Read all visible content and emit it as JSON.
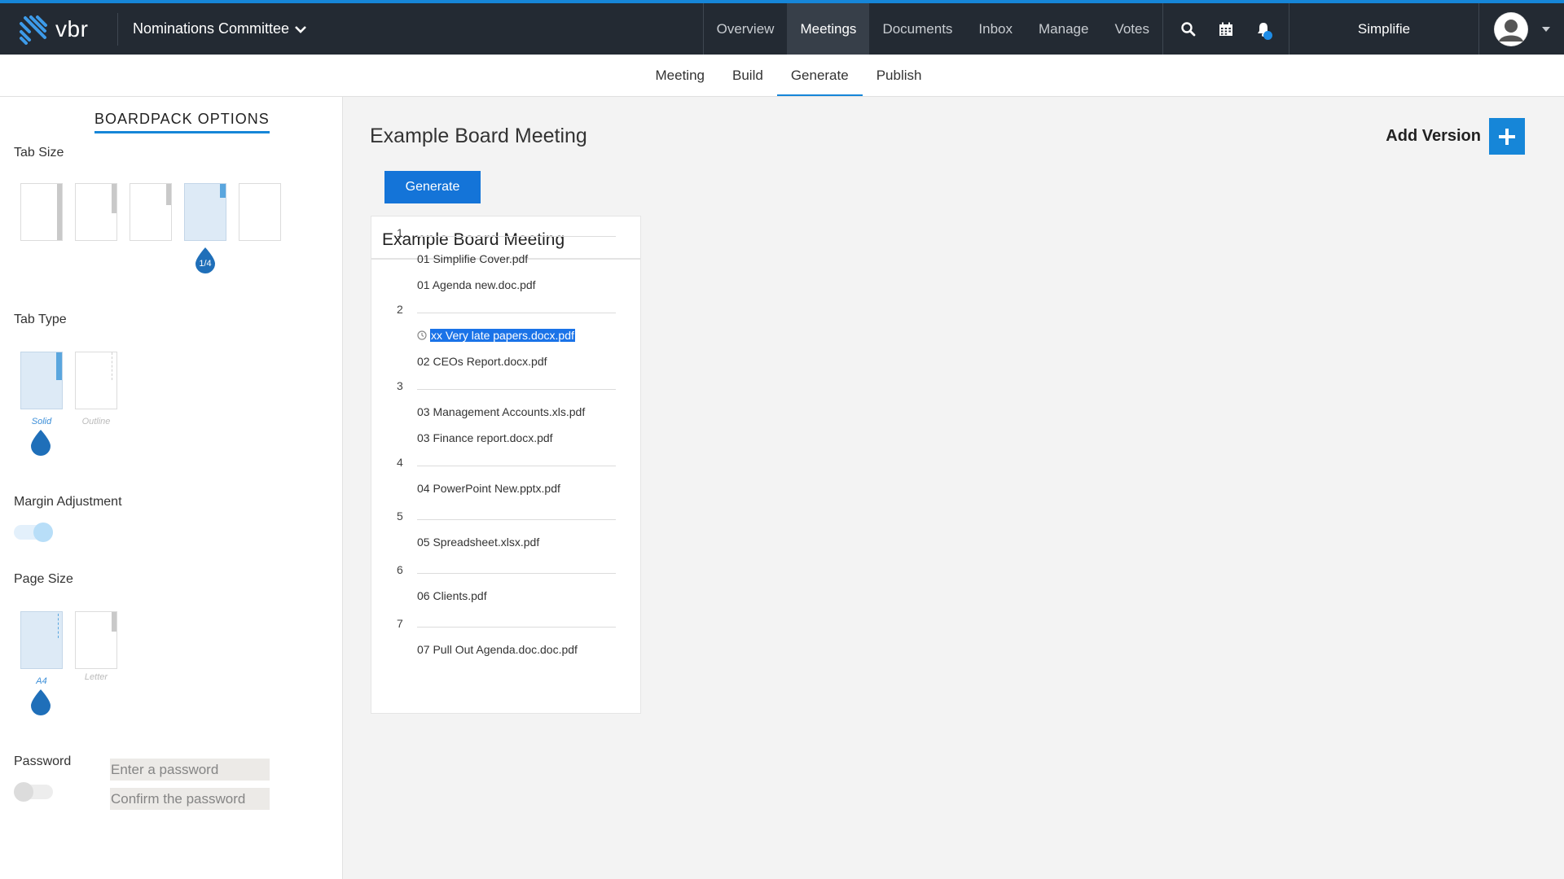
{
  "brand": {
    "name": "vbr",
    "accent": "#1686d8",
    "nav_bg": "#232a33"
  },
  "header": {
    "committee": "Nominations Committee",
    "nav": [
      "Overview",
      "Meetings",
      "Documents",
      "Inbox",
      "Manage",
      "Votes"
    ],
    "active_nav": "Meetings",
    "icons": [
      "search-icon",
      "calendar-icon",
      "bell-icon"
    ],
    "org": "Simplifie"
  },
  "subnav": {
    "items": [
      "Meeting",
      "Build",
      "Generate",
      "Publish"
    ],
    "active": "Generate"
  },
  "sidebar": {
    "title": "BOARDPACK OPTIONS",
    "tab_size": {
      "label": "Tab Size",
      "selected_badge": "1/4",
      "selected_index": 3
    },
    "tab_type": {
      "label": "Tab Type",
      "options": [
        "Solid",
        "Outline"
      ],
      "selected": "Solid"
    },
    "margin": {
      "label": "Margin Adjustment",
      "enabled": true
    },
    "page_size": {
      "label": "Page Size",
      "options": [
        "A4",
        "Letter"
      ],
      "selected": "A4"
    },
    "password": {
      "label": "Password",
      "enabled": false,
      "placeholder": "Enter a password",
      "confirm_placeholder": "Confirm the password"
    }
  },
  "main": {
    "title": "Example Board Meeting",
    "add_version_label": "Add Version",
    "generate_label": "Generate",
    "pack": {
      "title": "Example Board Meeting",
      "sections": [
        {
          "num": "1",
          "files": [
            {
              "name": "01 Simplifie Cover.pdf"
            },
            {
              "name": "01 Agenda new.doc.pdf"
            }
          ]
        },
        {
          "num": "2",
          "files": [
            {
              "name": "xx Very late papers.docx.pdf",
              "highlighted": true,
              "icon": "clock-icon"
            },
            {
              "name": "02 CEOs Report.docx.pdf"
            }
          ]
        },
        {
          "num": "3",
          "files": [
            {
              "name": "03 Management Accounts.xls.pdf"
            },
            {
              "name": "03 Finance report.docx.pdf"
            }
          ]
        },
        {
          "num": "4",
          "files": [
            {
              "name": "04 PowerPoint New.pptx.pdf"
            }
          ]
        },
        {
          "num": "5",
          "files": [
            {
              "name": "05 Spreadsheet.xlsx.pdf"
            }
          ]
        },
        {
          "num": "6",
          "files": [
            {
              "name": "06 Clients.pdf"
            }
          ]
        },
        {
          "num": "7",
          "files": [
            {
              "name": "07 Pull Out Agenda.doc.doc.pdf"
            }
          ]
        }
      ]
    }
  }
}
